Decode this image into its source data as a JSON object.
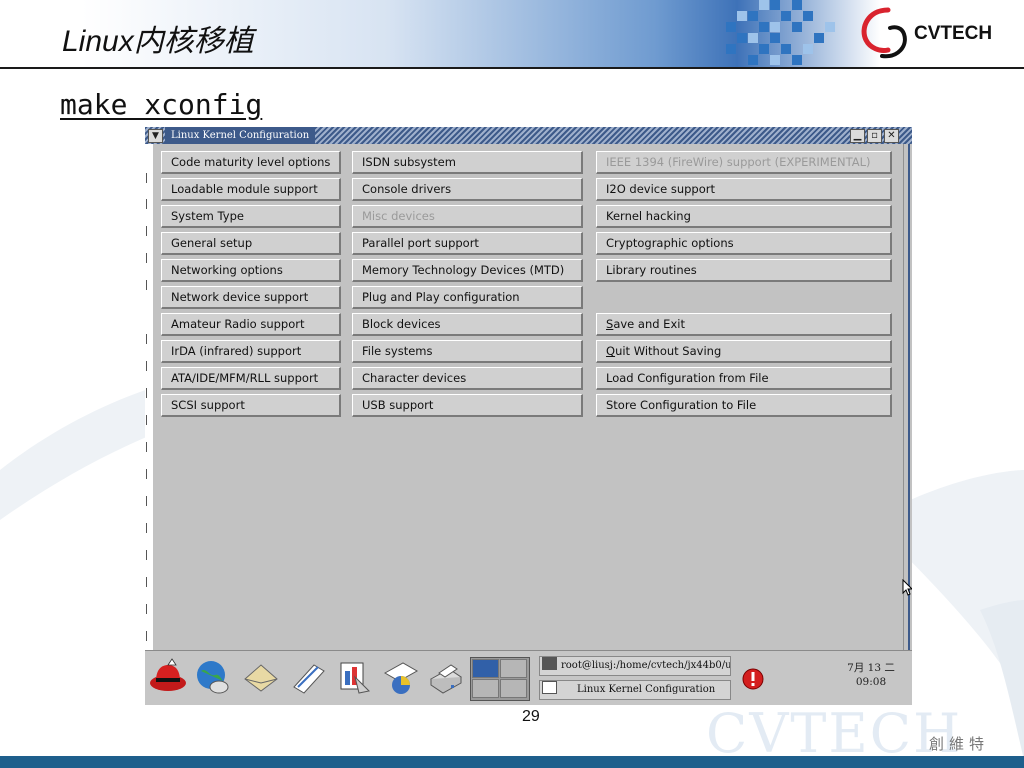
{
  "slide": {
    "title": "Linux内核移植",
    "command": "make xconfig",
    "page_number": "29",
    "logo_text": "CVTECH",
    "watermark": "CVTECH",
    "brand_cn": "創維特"
  },
  "window": {
    "title": "Linux Kernel Configuration"
  },
  "buttons": {
    "col1": [
      {
        "label": "Code maturity level options"
      },
      {
        "label": "Loadable module support"
      },
      {
        "label": "System Type"
      },
      {
        "label": "General setup"
      },
      {
        "label": "Networking options"
      },
      {
        "label": "Network device support"
      },
      {
        "label": "Amateur Radio support"
      },
      {
        "label": "IrDA (infrared) support"
      },
      {
        "label": "ATA/IDE/MFM/RLL support"
      },
      {
        "label": "SCSI support"
      }
    ],
    "col2": [
      {
        "label": "ISDN subsystem"
      },
      {
        "label": "Console drivers"
      },
      {
        "label": "Misc devices"
      },
      {
        "label": "Parallel port support"
      },
      {
        "label": "Memory Technology Devices (MTD)"
      },
      {
        "label": "Plug and Play configuration"
      },
      {
        "label": "Block devices"
      },
      {
        "label": "File systems"
      },
      {
        "label": "Character devices"
      },
      {
        "label": "USB support"
      }
    ],
    "col3": [
      {
        "label": "IEEE 1394 (FireWire) support (EXPERIMENTAL)"
      },
      {
        "label": "I2O device support"
      },
      {
        "label": "Kernel hacking"
      },
      {
        "label": "Cryptographic options"
      },
      {
        "label": "Library routines"
      }
    ],
    "actions": [
      {
        "mnemonic": "S",
        "rest": "ave and Exit"
      },
      {
        "mnemonic": "Q",
        "rest": "uit Without Saving"
      },
      {
        "label": "Load Configuration from File"
      },
      {
        "label": "Store Configuration to File"
      }
    ]
  },
  "taskbar": {
    "tasks": [
      {
        "label": "root@liusj:/home/cvtech/jx44b0/u("
      },
      {
        "label": "Linux Kernel Configuration"
      }
    ],
    "clock_date": "7月 13 二",
    "clock_time": "09:08"
  },
  "colors": {
    "titlebar": "#3d5a8a",
    "footer": "#1e5f8c",
    "button_face": "#d0d0d0",
    "disabled_text": "#9a9a9a"
  }
}
